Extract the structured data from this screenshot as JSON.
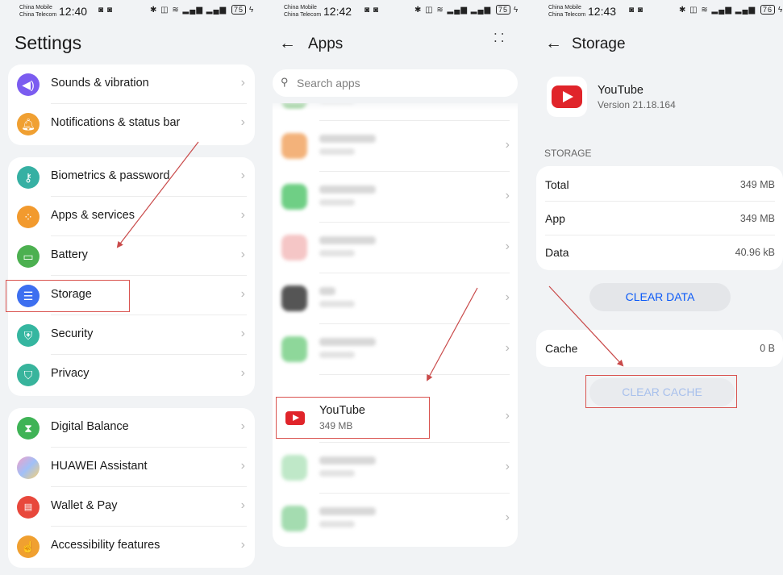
{
  "colors": {
    "accent": "#0a59f7",
    "highlight": "#d9534f",
    "youtube_red": "#e0242a"
  },
  "screen1": {
    "status": {
      "carrier1": "China Mobile",
      "carrier2": "China Telecom",
      "time": "12:40",
      "battery": "75"
    },
    "title": "Settings",
    "groups": [
      {
        "items": [
          {
            "label": "Sounds & vibration",
            "icon": "speaker-icon",
            "color": "#7b5cf0"
          },
          {
            "label": "Notifications & status bar",
            "icon": "bell-icon",
            "color": "#f0a032"
          }
        ]
      },
      {
        "items": [
          {
            "label": "Biometrics & password",
            "icon": "key-icon",
            "color": "#36b0a3"
          },
          {
            "label": "Apps & services",
            "icon": "apps-grid-icon",
            "color": "#f29a2e"
          },
          {
            "label": "Battery",
            "icon": "battery-icon",
            "color": "#4cb050"
          },
          {
            "label": "Storage",
            "icon": "storage-icon",
            "color": "#3d6ff0"
          },
          {
            "label": "Security",
            "icon": "shield-check-icon",
            "color": "#35b6a0"
          },
          {
            "label": "Privacy",
            "icon": "shield-user-icon",
            "color": "#38b49c"
          }
        ]
      },
      {
        "items": [
          {
            "label": "Digital Balance",
            "icon": "hourglass-icon",
            "color": "#3fb356"
          },
          {
            "label": "HUAWEI Assistant",
            "icon": "assistant-icon",
            "color": "#c58ae0"
          },
          {
            "label": "Wallet & Pay",
            "icon": "wallet-icon",
            "color": "#e8483c"
          },
          {
            "label": "Accessibility features",
            "icon": "hand-icon",
            "color": "#f0a030"
          }
        ]
      }
    ]
  },
  "screen2": {
    "status": {
      "carrier1": "China Mobile",
      "carrier2": "China Telecom",
      "time": "12:42",
      "battery": "75"
    },
    "title": "Apps",
    "search_placeholder": "Search apps",
    "youtube": {
      "name": "YouTube",
      "size": "349 MB"
    }
  },
  "screen3": {
    "status": {
      "carrier1": "China Mobile",
      "carrier2": "China Telecom",
      "time": "12:43",
      "battery": "76"
    },
    "title": "Storage",
    "app_name": "YouTube",
    "app_version": "Version 21.18.164",
    "section": "STORAGE",
    "rows": [
      {
        "label": "Total",
        "value": "349 MB"
      },
      {
        "label": "App",
        "value": "349 MB"
      },
      {
        "label": "Data",
        "value": "40.96 kB"
      }
    ],
    "clear_data": "CLEAR DATA",
    "cache_label": "Cache",
    "cache_value": "0 B",
    "clear_cache": "CLEAR CACHE"
  }
}
